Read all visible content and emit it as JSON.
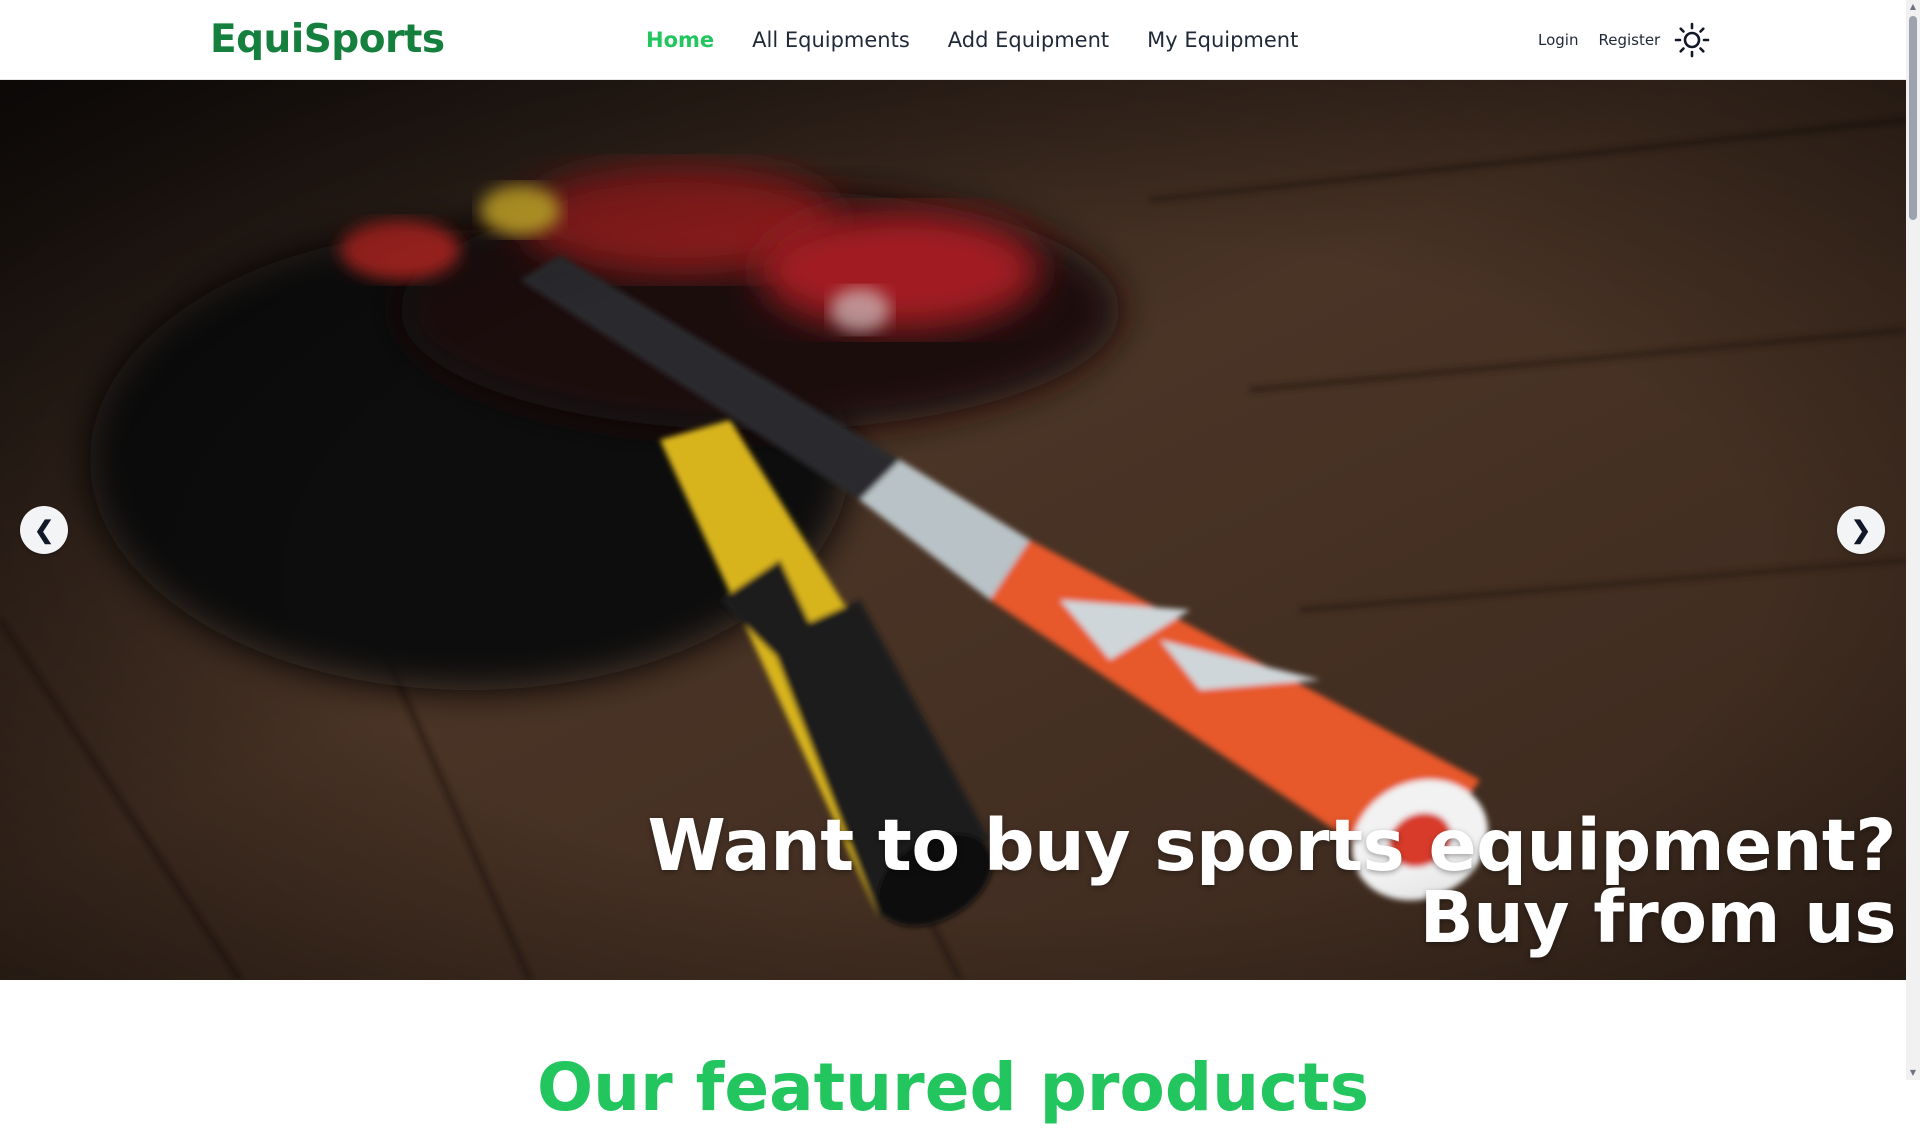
{
  "header": {
    "brand": "EquiSports",
    "nav": [
      {
        "label": "Home",
        "active": true
      },
      {
        "label": "All Equipments",
        "active": false
      },
      {
        "label": "Add Equipment",
        "active": false
      },
      {
        "label": "My Equipment",
        "active": false
      }
    ],
    "login_label": "Login",
    "register_label": "Register",
    "theme_icon": "sun-icon"
  },
  "hero": {
    "caption_line1": "Want to buy sports equipment?",
    "caption_line2": "Buy from us",
    "prev_label": "❮",
    "next_label": "❯"
  },
  "section": {
    "heading": "Our featured products"
  },
  "colors": {
    "brand": "#15803d",
    "active_nav": "#22c55e",
    "text": "#1f2937",
    "heading": "#22c55e"
  }
}
